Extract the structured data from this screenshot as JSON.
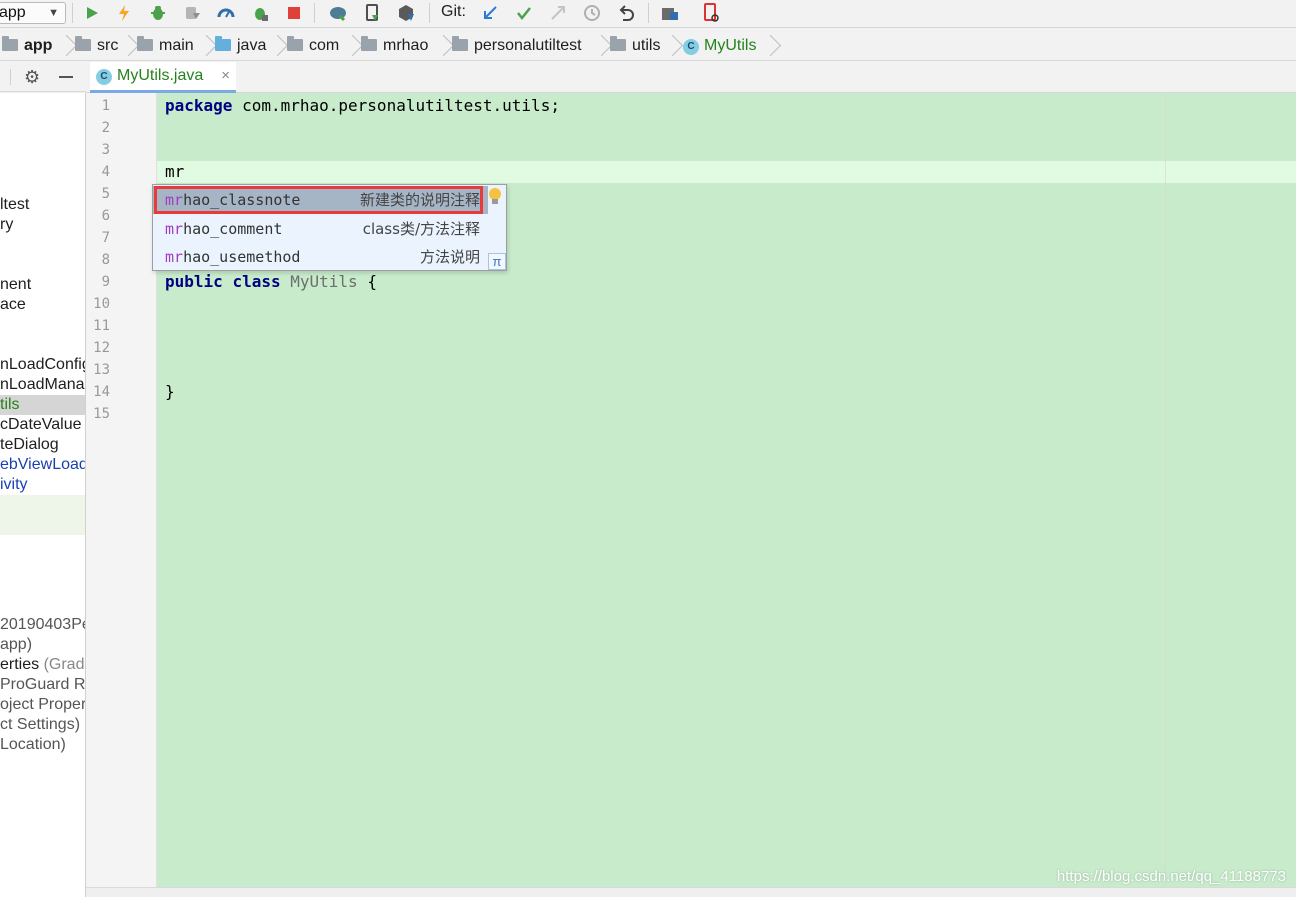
{
  "toolbar": {
    "config": "app",
    "git_label": "Git:"
  },
  "breadcrumb": [
    {
      "label": "app",
      "icon": "module-folder-icon"
    },
    {
      "label": "src",
      "icon": "folder-icon"
    },
    {
      "label": "main",
      "icon": "folder-icon"
    },
    {
      "label": "java",
      "icon": "source-folder-icon"
    },
    {
      "label": "com",
      "icon": "package-icon"
    },
    {
      "label": "mrhao",
      "icon": "package-icon"
    },
    {
      "label": "personalutiltest",
      "icon": "package-icon"
    },
    {
      "label": "utils",
      "icon": "package-icon"
    },
    {
      "label": "MyUtils",
      "icon": "class-icon"
    }
  ],
  "project_tree": [
    "ltest",
    "ry",
    "nent",
    "ace",
    "nLoadConfig",
    "nLoadMana",
    "tils",
    "cDateValue",
    "teDialog",
    "ebViewLoad",
    "ivity",
    "20190403Pe",
    " app)",
    "erties",
    "(Grad",
    "ProGuard Ru",
    "oject Proper",
    "ct Settings)",
    "Location)"
  ],
  "tab": {
    "label": "MyUtils.java",
    "close": "×"
  },
  "editor": {
    "line_numbers": [
      "1",
      "2",
      "3",
      "4",
      "5",
      "6",
      "7",
      "8",
      "9",
      "10",
      "11",
      "12",
      "13",
      "14",
      "15"
    ],
    "line1_kw": "package",
    "line1_rest": " com.mrhao.personalutiltest.utils;",
    "line4": "mr",
    "line9_kw1": "public",
    "line9_kw2": "class",
    "line9_cls": "MyUtils",
    "line9_brace": " {",
    "line14": "}"
  },
  "completion": {
    "items": [
      {
        "match": "mr",
        "rest": "hao_classnote",
        "desc": "新建类的说明注释"
      },
      {
        "match": "mr",
        "rest": "hao_comment",
        "desc": "class类/方法注释"
      },
      {
        "match": "mr",
        "rest": "hao_usemethod",
        "desc": "方法说明"
      }
    ],
    "pi_symbol": "π"
  },
  "watermark": "https://blog.csdn.net/qq_41188773",
  "colors": {
    "editor_bg": "#c7ebcb",
    "caret_line": "#e1fae2",
    "keyword": "#000080",
    "selection_outline": "#e83a3a",
    "popup_bg": "#ebf4fe"
  }
}
